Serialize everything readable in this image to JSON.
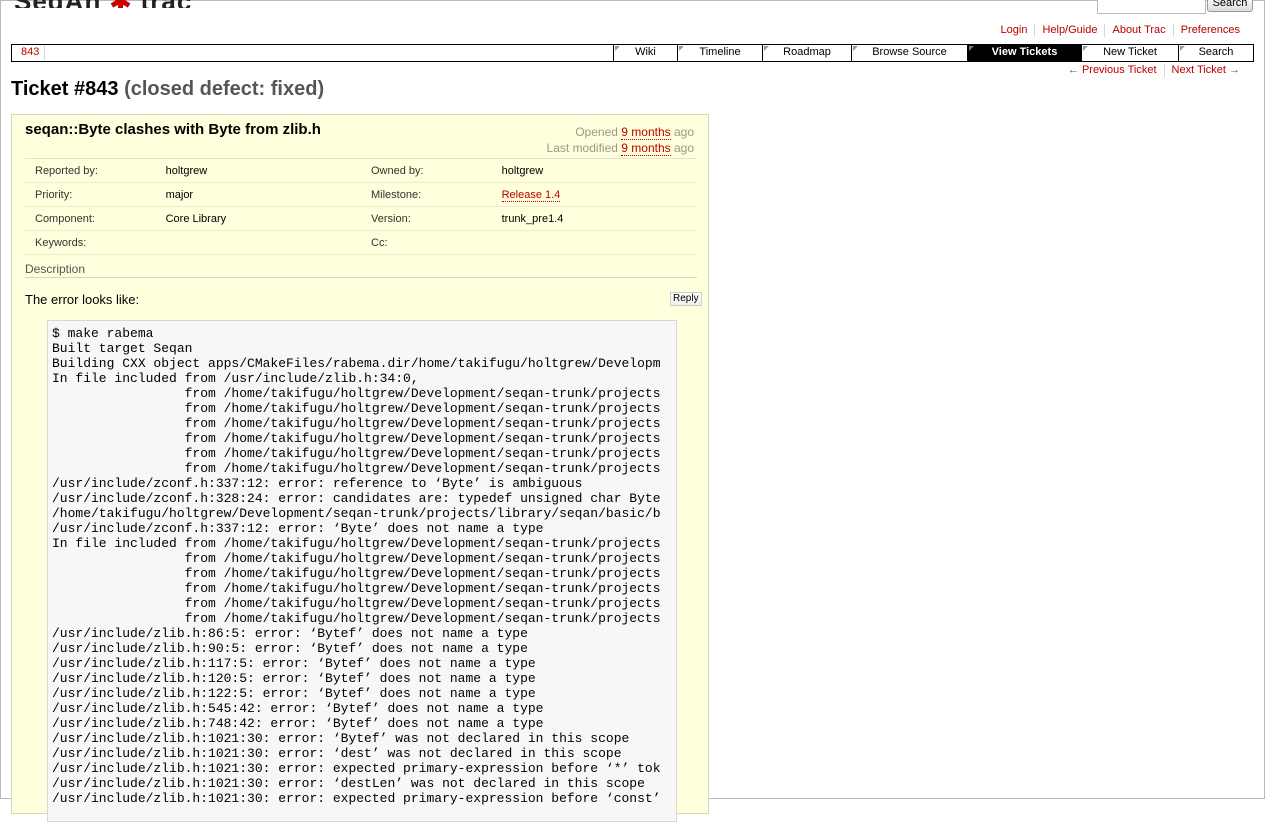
{
  "header": {
    "logo_text_a": "SeqAn",
    "logo_text_b": "trac",
    "search_button": "Search",
    "search_value": ""
  },
  "metanav": [
    "Login",
    "Help/Guide",
    "About Trac",
    "Preferences"
  ],
  "mainnav": {
    "context_link": "843",
    "tabs": [
      "Wiki",
      "Timeline",
      "Roadmap",
      "Browse Source",
      "View Tickets",
      "New Ticket",
      "Search"
    ],
    "active_tab": "View Tickets"
  },
  "ticket_nav": {
    "prev_arrow": "←",
    "prev": "Previous Ticket",
    "next": "Next Ticket",
    "next_arrow": "→"
  },
  "ticket": {
    "title": "Ticket #843",
    "status": "(closed defect: fixed)",
    "summary": "seqan::Byte clashes with Byte from zlib.h",
    "opened_label": "Opened",
    "opened_value": "9 months",
    "opened_suffix": "ago",
    "modified_label": "Last modified",
    "modified_value": "9 months",
    "modified_suffix": "ago",
    "props": [
      {
        "l1": "Reported by:",
        "v1": "holtgrew",
        "l2": "Owned by:",
        "v2": "holtgrew"
      },
      {
        "l1": "Priority:",
        "v1": "major",
        "l2": "Milestone:",
        "v2": "Release 1.4"
      },
      {
        "l1": "Component:",
        "v1": "Core Library",
        "l2": "Version:",
        "v2": "trunk_pre1.4"
      },
      {
        "l1": "Keywords:",
        "v1": "",
        "l2": "Cc:",
        "v2": ""
      }
    ],
    "description_heading": "Description",
    "description_intro": "The error looks like:",
    "reply_button": "Reply",
    "code": "$ make rabema\nBuilt target Seqan\nBuilding CXX object apps/CMakeFiles/rabema.dir/home/takifugu/holtgrew/Developm\nIn file included from /usr/include/zlib.h:34:0,\n                 from /home/takifugu/holtgrew/Development/seqan-trunk/projects\n                 from /home/takifugu/holtgrew/Development/seqan-trunk/projects\n                 from /home/takifugu/holtgrew/Development/seqan-trunk/projects\n                 from /home/takifugu/holtgrew/Development/seqan-trunk/projects\n                 from /home/takifugu/holtgrew/Development/seqan-trunk/projects\n                 from /home/takifugu/holtgrew/Development/seqan-trunk/projects\n/usr/include/zconf.h:337:12: error: reference to ‘Byte’ is ambiguous\n/usr/include/zconf.h:328:24: error: candidates are: typedef unsigned char Byte\n/home/takifugu/holtgrew/Development/seqan-trunk/projects/library/seqan/basic/b\n/usr/include/zconf.h:337:12: error: ‘Byte’ does not name a type\nIn file included from /home/takifugu/holtgrew/Development/seqan-trunk/projects\n                 from /home/takifugu/holtgrew/Development/seqan-trunk/projects\n                 from /home/takifugu/holtgrew/Development/seqan-trunk/projects\n                 from /home/takifugu/holtgrew/Development/seqan-trunk/projects\n                 from /home/takifugu/holtgrew/Development/seqan-trunk/projects\n                 from /home/takifugu/holtgrew/Development/seqan-trunk/projects\n/usr/include/zlib.h:86:5: error: ‘Bytef’ does not name a type\n/usr/include/zlib.h:90:5: error: ‘Bytef’ does not name a type\n/usr/include/zlib.h:117:5: error: ‘Bytef’ does not name a type\n/usr/include/zlib.h:120:5: error: ‘Bytef’ does not name a type\n/usr/include/zlib.h:122:5: error: ‘Bytef’ does not name a type\n/usr/include/zlib.h:545:42: error: ‘Bytef’ does not name a type\n/usr/include/zlib.h:748:42: error: ‘Bytef’ does not name a type\n/usr/include/zlib.h:1021:30: error: ‘Bytef’ was not declared in this scope\n/usr/include/zlib.h:1021:30: error: ‘dest’ was not declared in this scope\n/usr/include/zlib.h:1021:30: error: expected primary-expression before ‘*’ tok\n/usr/include/zlib.h:1021:30: error: ‘destLen’ was not declared in this scope\n/usr/include/zlib.h:1021:30: error: expected primary-expression before ‘const’"
  }
}
